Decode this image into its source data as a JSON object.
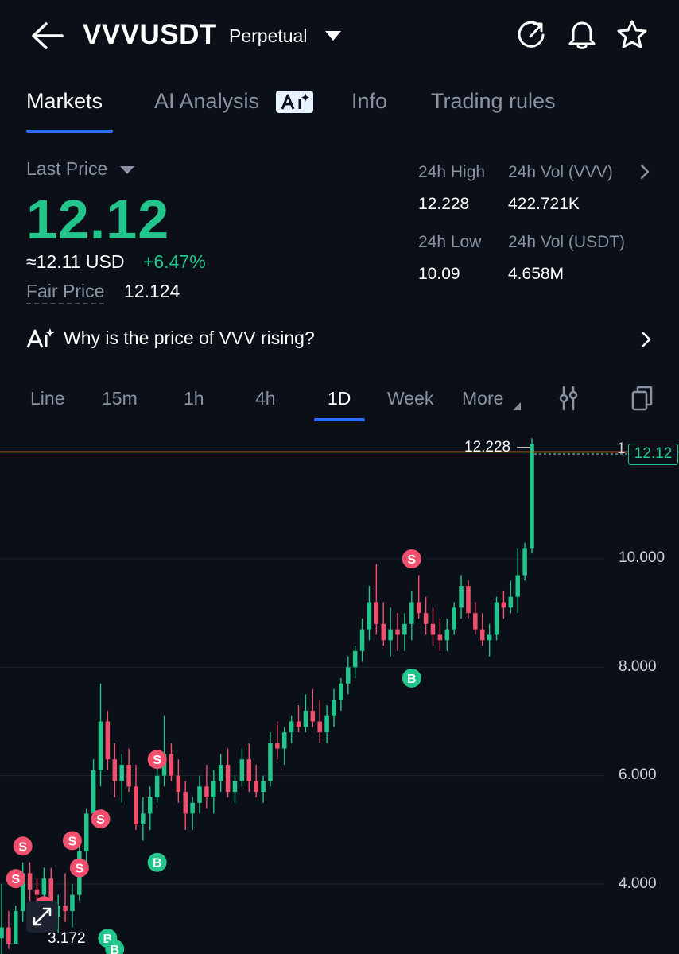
{
  "header": {
    "symbol": "VVVUSDT",
    "contract_type": "Perpetual"
  },
  "tabs": [
    {
      "label": "Markets"
    },
    {
      "label": "AI Analysis"
    },
    {
      "label": "Info"
    },
    {
      "label": "Trading rules"
    }
  ],
  "ticker": {
    "last_price_label": "Last Price",
    "last_price": "12.12",
    "usd_equiv": "≈12.11 USD",
    "change_pct": "+6.47%",
    "fair_price_label": "Fair Price",
    "fair_price": "12.124"
  },
  "stats": {
    "high_label": "24h High",
    "high": "12.228",
    "vol_base_label": "24h Vol (VVV)",
    "vol_base": "422.721K",
    "low_label": "24h Low",
    "low": "10.09",
    "vol_quote_label": "24h Vol  (USDT)",
    "vol_quote": "4.658M"
  },
  "ai_prompt": "Why is the price of VVV rising?",
  "timeframes": [
    {
      "label": "Line"
    },
    {
      "label": "15m"
    },
    {
      "label": "1h"
    },
    {
      "label": "4h"
    },
    {
      "label": "1D"
    },
    {
      "label": "Week"
    },
    {
      "label": "More"
    }
  ],
  "active_timeframe": "1D",
  "colors": {
    "up": "#22c58b",
    "down": "#f0506e",
    "accent": "#2f6bff",
    "price_line": "#f0773c"
  },
  "chart_data": {
    "type": "candlestick",
    "y_ticks": [
      "10.000",
      "8.000",
      "6.000",
      "4.000"
    ],
    "y_tick_values": [
      10,
      8,
      6,
      4
    ],
    "ylim": [
      2.6,
      12.9
    ],
    "period_high_marker": "12.228",
    "period_low_marker": "3.172",
    "current_price_tag": "12.12",
    "axis_edge_label": "1",
    "candles": [
      [
        3.0,
        4.0,
        2.6,
        3.2
      ],
      [
        3.2,
        3.5,
        2.8,
        2.9
      ],
      [
        2.9,
        3.6,
        2.9,
        3.5
      ],
      [
        3.5,
        4.4,
        3.3,
        4.2
      ],
      [
        4.2,
        4.4,
        3.6,
        3.9
      ],
      [
        3.9,
        4.1,
        3.5,
        3.8
      ],
      [
        3.8,
        4.3,
        3.6,
        4.1
      ],
      [
        4.1,
        4.3,
        3.2,
        3.4
      ],
      [
        3.4,
        3.8,
        3.1,
        3.6
      ],
      [
        3.6,
        4.2,
        3.3,
        3.5
      ],
      [
        3.5,
        4.0,
        3.2,
        3.8
      ],
      [
        3.8,
        4.7,
        3.7,
        4.6
      ],
      [
        4.6,
        5.4,
        4.4,
        5.3
      ],
      [
        5.3,
        6.3,
        5.2,
        6.1
      ],
      [
        6.1,
        7.7,
        5.8,
        7.0
      ],
      [
        7.0,
        7.2,
        6.1,
        6.3
      ],
      [
        6.3,
        6.6,
        5.6,
        5.9
      ],
      [
        5.9,
        6.4,
        5.5,
        6.2
      ],
      [
        6.2,
        6.5,
        5.7,
        5.8
      ],
      [
        5.8,
        6.2,
        5.0,
        5.1
      ],
      [
        5.1,
        5.6,
        4.8,
        5.3
      ],
      [
        5.3,
        5.8,
        5.0,
        5.6
      ],
      [
        5.6,
        6.2,
        5.5,
        6.0
      ],
      [
        6.0,
        7.1,
        5.8,
        6.4
      ],
      [
        6.4,
        6.6,
        5.9,
        6.0
      ],
      [
        6.0,
        6.3,
        5.5,
        5.7
      ],
      [
        5.7,
        5.9,
        5.0,
        5.3
      ],
      [
        5.3,
        5.6,
        5.0,
        5.5
      ],
      [
        5.5,
        6.0,
        5.3,
        5.8
      ],
      [
        5.8,
        6.2,
        5.4,
        5.6
      ],
      [
        5.6,
        6.1,
        5.3,
        5.9
      ],
      [
        5.9,
        6.4,
        5.7,
        6.2
      ],
      [
        6.2,
        6.5,
        5.6,
        5.7
      ],
      [
        5.7,
        6.0,
        5.5,
        5.9
      ],
      [
        5.9,
        6.5,
        5.8,
        6.3
      ],
      [
        6.3,
        6.6,
        5.7,
        5.9
      ],
      [
        5.9,
        6.2,
        5.6,
        5.7
      ],
      [
        5.7,
        6.0,
        5.5,
        5.9
      ],
      [
        5.9,
        6.8,
        5.8,
        6.6
      ],
      [
        6.6,
        7.0,
        6.3,
        6.5
      ],
      [
        6.5,
        6.9,
        6.2,
        6.8
      ],
      [
        6.8,
        7.1,
        6.6,
        7.0
      ],
      [
        7.0,
        7.3,
        6.8,
        6.9
      ],
      [
        6.9,
        7.5,
        6.8,
        7.2
      ],
      [
        7.2,
        7.6,
        6.9,
        7.0
      ],
      [
        7.0,
        7.4,
        6.6,
        6.8
      ],
      [
        6.8,
        7.3,
        6.6,
        7.1
      ],
      [
        7.1,
        7.6,
        6.9,
        7.4
      ],
      [
        7.4,
        7.8,
        7.2,
        7.7
      ],
      [
        7.7,
        8.2,
        7.5,
        8.0
      ],
      [
        8.0,
        8.4,
        7.8,
        8.3
      ],
      [
        8.3,
        8.9,
        8.1,
        8.7
      ],
      [
        8.7,
        9.5,
        8.5,
        9.2
      ],
      [
        9.2,
        9.9,
        8.6,
        8.8
      ],
      [
        8.8,
        9.2,
        8.4,
        8.5
      ],
      [
        8.5,
        9.1,
        8.2,
        8.7
      ],
      [
        8.7,
        9.0,
        8.3,
        8.6
      ],
      [
        8.6,
        9.0,
        8.3,
        8.8
      ],
      [
        8.8,
        9.4,
        8.5,
        9.2
      ],
      [
        9.2,
        9.7,
        8.9,
        9.0
      ],
      [
        9.0,
        9.3,
        8.6,
        8.8
      ],
      [
        8.8,
        9.1,
        8.4,
        8.6
      ],
      [
        8.6,
        8.9,
        8.3,
        8.5
      ],
      [
        8.5,
        8.9,
        8.3,
        8.7
      ],
      [
        8.7,
        9.2,
        8.6,
        9.1
      ],
      [
        9.1,
        9.7,
        8.9,
        9.5
      ],
      [
        9.5,
        9.6,
        8.9,
        9.0
      ],
      [
        9.0,
        9.2,
        8.6,
        8.7
      ],
      [
        8.7,
        9.0,
        8.4,
        8.5
      ],
      [
        8.5,
        8.8,
        8.2,
        8.6
      ],
      [
        8.6,
        9.3,
        8.5,
        9.2
      ],
      [
        9.2,
        9.4,
        8.9,
        9.1
      ],
      [
        9.1,
        9.6,
        9.0,
        9.3
      ],
      [
        9.3,
        10.2,
        9.0,
        9.7
      ],
      [
        9.7,
        10.3,
        9.6,
        10.2
      ],
      [
        10.2,
        12.228,
        10.1,
        12.12
      ]
    ],
    "markers": [
      {
        "type": "S",
        "candle": 2,
        "price": 4.1
      },
      {
        "type": "S",
        "candle": 3,
        "price": 4.7
      },
      {
        "type": "S",
        "candle": 6,
        "price": 3.6
      },
      {
        "type": "S",
        "candle": 10,
        "price": 4.8
      },
      {
        "type": "S",
        "candle": 11,
        "price": 4.3
      },
      {
        "type": "S",
        "candle": 14,
        "price": 5.2
      },
      {
        "type": "B",
        "candle": 15,
        "price": 3.0
      },
      {
        "type": "B",
        "candle": 16,
        "price": 2.8
      },
      {
        "type": "S",
        "candle": 22,
        "price": 6.3
      },
      {
        "type": "B",
        "candle": 22,
        "price": 4.4
      },
      {
        "type": "S",
        "candle": 58,
        "price": 10.0
      },
      {
        "type": "B",
        "candle": 58,
        "price": 7.8
      }
    ]
  }
}
